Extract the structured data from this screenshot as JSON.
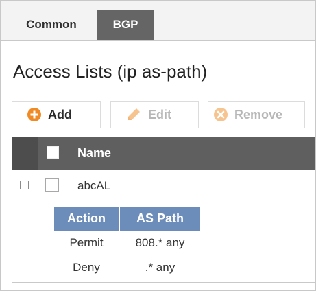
{
  "tabs": [
    {
      "label": "Common",
      "active": false
    },
    {
      "label": "BGP",
      "active": true
    }
  ],
  "page_title": "Access Lists (ip as-path)",
  "toolbar": {
    "add_label": "Add",
    "edit_label": "Edit",
    "remove_label": "Remove",
    "add_icon": "plus-circle-icon",
    "edit_icon": "pencil-icon",
    "remove_icon": "x-circle-icon"
  },
  "grid": {
    "columns": [
      "Name"
    ],
    "rows": [
      {
        "name": "abcAL",
        "expanded": true,
        "entries": {
          "columns": [
            "Action",
            "AS Path"
          ],
          "rows": [
            [
              "Permit",
              "808.* any"
            ],
            [
              "Deny",
              ".* any"
            ]
          ]
        }
      }
    ]
  },
  "colors": {
    "active_tab": "#656565",
    "grid_header": "#5f5f5f",
    "sub_header": "#6c8cb9",
    "add_icon": "#f08a24",
    "disabled_icon": "#f6c48f"
  }
}
